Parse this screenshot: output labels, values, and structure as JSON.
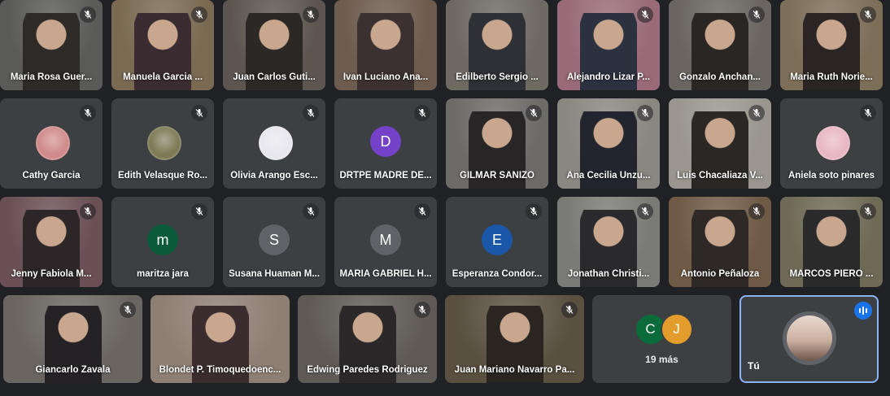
{
  "tiles": [
    {
      "name": "Maria Rosa Guer...",
      "kind": "video",
      "muted": true,
      "bg": "#5a5a58",
      "fg": "#2d2a28"
    },
    {
      "name": "Manuela Garcia ...",
      "kind": "video",
      "muted": true,
      "bg": "#7a6a52",
      "fg": "#3a2c30"
    },
    {
      "name": "Juan Carlos Guti...",
      "kind": "video",
      "muted": true,
      "bg": "#5c5550",
      "fg": "#2b2826"
    },
    {
      "name": "Ivan Luciano Ana...",
      "kind": "video",
      "muted": false,
      "bg": "#6d5b4d",
      "fg": "#3b3130"
    },
    {
      "name": "Edilberto Sergio ...",
      "kind": "video",
      "muted": false,
      "bg": "#6e6a62",
      "fg": "#2f3035"
    },
    {
      "name": "Alejandro Lizar P...",
      "kind": "video",
      "muted": true,
      "bg": "#9a6a78",
      "fg": "#2c3140"
    },
    {
      "name": "Gonzalo Anchan...",
      "kind": "video",
      "muted": true,
      "bg": "#6a6560",
      "fg": "#2a2624"
    },
    {
      "name": "Maria Ruth Norie...",
      "kind": "video",
      "muted": true,
      "bg": "#7d6e58",
      "fg": "#2a2424"
    },
    {
      "name": "Cathy Garcia",
      "kind": "photo-avatar",
      "muted": true,
      "color": "#d08a8a"
    },
    {
      "name": "Edith Velasque Ro...",
      "kind": "photo-avatar",
      "muted": true,
      "color": "#7d7a55"
    },
    {
      "name": "Olivia Arango Esc...",
      "kind": "photo-avatar",
      "muted": true,
      "color": "#e9e7ee"
    },
    {
      "name": "DRTPE MADRE DE...",
      "kind": "letter",
      "letter": "D",
      "muted": true,
      "color": "#7442c8"
    },
    {
      "name": "GILMAR SANIZO",
      "kind": "video",
      "muted": true,
      "bg": "#6d6a68",
      "fg": "#272525"
    },
    {
      "name": "Ana Cecilia Unzu...",
      "kind": "video",
      "muted": true,
      "bg": "#8a8680",
      "fg": "#23252e"
    },
    {
      "name": "Luis Chacaliaza V...",
      "kind": "video",
      "muted": true,
      "bg": "#9a968f",
      "fg": "#2b2725"
    },
    {
      "name": "Aniela soto pinares",
      "kind": "photo-avatar",
      "muted": true,
      "color": "#e8b7c4"
    },
    {
      "name": "Jenny Fabiola M...",
      "kind": "video",
      "muted": true,
      "bg": "#6a4f55",
      "fg": "#2c2628"
    },
    {
      "name": "maritza jara",
      "kind": "letter",
      "letter": "m",
      "muted": true,
      "color": "#0b5a3a"
    },
    {
      "name": "Susana Huaman M...",
      "kind": "letter",
      "letter": "S",
      "muted": true,
      "color": "#5f6368"
    },
    {
      "name": "MARÍA GABRIEL H...",
      "kind": "letter",
      "letter": "M",
      "muted": true,
      "color": "#5f6368"
    },
    {
      "name": "Esperanza Condor...",
      "kind": "letter",
      "letter": "E",
      "muted": true,
      "color": "#1a57a8"
    },
    {
      "name": "Jonathan Christi...",
      "kind": "video",
      "muted": true,
      "bg": "#7a7a76",
      "fg": "#2a2a2c"
    },
    {
      "name": "Antonio Peñaloza",
      "kind": "video",
      "muted": true,
      "bg": "#6f5a45",
      "fg": "#2e2826"
    },
    {
      "name": "MARCOS PIERO ...",
      "kind": "video",
      "muted": true,
      "bg": "#6e6a55",
      "fg": "#2a2a2a"
    },
    {
      "name": "Giancarlo Zavala",
      "kind": "video",
      "muted": true,
      "bg": "#6a6560",
      "fg": "#242224"
    },
    {
      "name": "Blondet P. Timoquedoenc...",
      "kind": "video",
      "muted": false,
      "bg": "#8e7f74",
      "fg": "#3b2d2f"
    },
    {
      "name": "Edwing Paredes Rodriguez",
      "kind": "video",
      "muted": true,
      "bg": "#5f5a55",
      "fg": "#2a2828"
    },
    {
      "name": "Juan Mariano Navarro Pa...",
      "kind": "video",
      "muted": true,
      "bg": "#5a5040",
      "fg": "#2a2520"
    }
  ],
  "more": {
    "label": "19 más",
    "avatars": [
      {
        "letter": "C",
        "color": "#0b6b3a"
      },
      {
        "letter": "J",
        "color": "#e29d2c"
      }
    ]
  },
  "self": {
    "label": "Tú"
  }
}
